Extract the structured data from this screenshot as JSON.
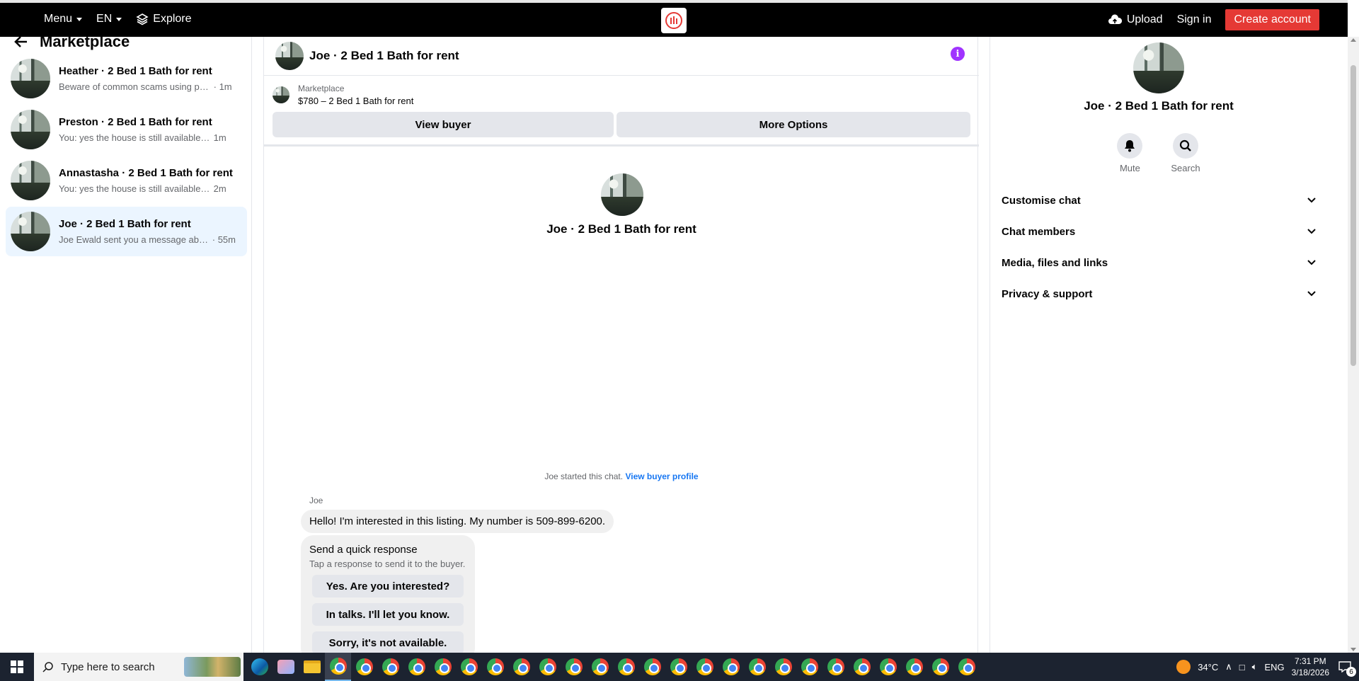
{
  "topbar": {
    "menu_label": "Menu",
    "lang_label": "EN",
    "explore_label": "Explore",
    "upload_label": "Upload",
    "signin_label": "Sign in",
    "create_label": "Create account"
  },
  "sidebar": {
    "title": "Marketplace",
    "conversations": [
      {
        "name": "Heather · 2 Bed 1 Bath for rent",
        "preview": "Beware of common scams using pay...",
        "time": "· 1m"
      },
      {
        "name": "Preston · 2 Bed 1 Bath for rent",
        "preview": "You: yes the house is still available for...",
        "time": "1m"
      },
      {
        "name": "Annastasha · 2 Bed 1 Bath for rent",
        "preview": "You: yes the house is still available for...",
        "time": "2m"
      },
      {
        "name": "Joe · 2 Bed 1 Bath for rent",
        "preview": "Joe Ewald sent you a message abou...",
        "time": "· 55m"
      }
    ]
  },
  "chat": {
    "title": "Joe · 2 Bed 1 Bath for rent",
    "listing_source": "Marketplace",
    "listing_title": "$780 – 2 Bed 1 Bath for rent",
    "view_buyer_label": "View buyer",
    "more_options_label": "More Options",
    "center_name": "Joe · 2 Bed 1 Bath for rent",
    "started_text": "Joe started this chat.",
    "view_profile_label": "View buyer profile",
    "sender": "Joe",
    "message": "Hello! I'm interested in this listing. My number is 509-899-6200.",
    "quick_title": "Send a quick response",
    "quick_subtitle": "Tap a response to send it to the buyer.",
    "quick_replies": [
      "Yes. Are you interested?",
      "In talks. I'll let you know.",
      "Sorry, it's not available."
    ]
  },
  "details": {
    "name": "Joe · 2 Bed 1 Bath for rent",
    "mute_label": "Mute",
    "search_label": "Search",
    "sections": [
      "Customise chat",
      "Chat members",
      "Media, files and links",
      "Privacy & support"
    ]
  },
  "taskbar": {
    "search_placeholder": "Type here to search",
    "temperature": "34°C",
    "lang": "ENG",
    "time": "7:31 PM",
    "date": "3/18/2026",
    "notifications": "6"
  },
  "colors": {
    "accent_red": "#e53935",
    "info_purple": "#a033ff",
    "link_blue": "#1877f2",
    "active_row": "#ebf5ff"
  }
}
